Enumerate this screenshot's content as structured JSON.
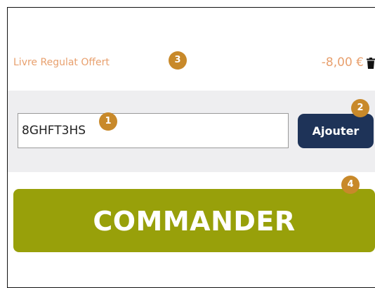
{
  "discount": {
    "label": "Livre Regulat Offert",
    "amount": "-8,00 €",
    "remove_icon": "trash-icon"
  },
  "promo": {
    "code_value": "8GHFT3HS",
    "add_label": "Ajouter"
  },
  "order": {
    "label": "COMMANDER"
  },
  "markers": [
    "1",
    "2",
    "3",
    "4"
  ],
  "colors": {
    "discount_text": "#e8a06e",
    "panel_bg": "#eeeef0",
    "add_button": "#1e3358",
    "order_button": "#98a00a",
    "marker": "#c8892a"
  }
}
